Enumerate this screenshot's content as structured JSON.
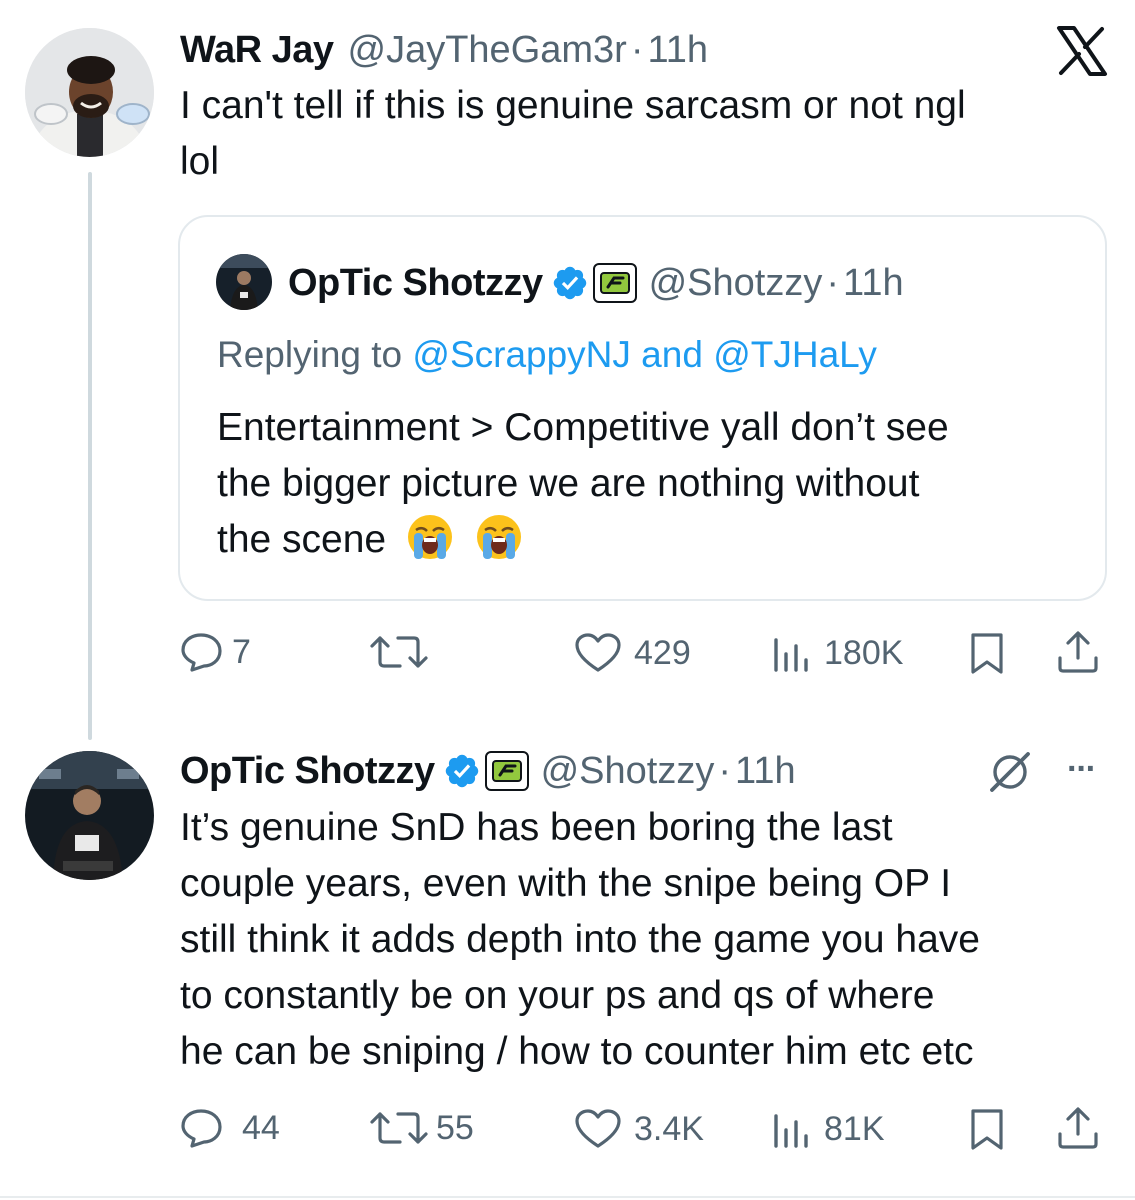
{
  "tweet1": {
    "author_name": "WaR Jay",
    "handle": "@JayTheGam3r",
    "time": "11h",
    "text_line1": "I can't tell if this is genuine sarcasm or not ngl",
    "text_line2": "lol",
    "quote": {
      "author_name": "OpTic Shotzzy",
      "handle": "@Shotzzy",
      "time": "11h",
      "replying_prefix": "Replying to ",
      "replying_user1": "@ScrappyNJ",
      "replying_and": " and ",
      "replying_user2": "@TJHaLy",
      "text_line1": "Entertainment > Competitive yall don’t see",
      "text_line2": "the bigger picture we are nothing without",
      "text_line3": "the scene"
    },
    "actions": {
      "replies": "7",
      "reposts": "",
      "likes": "429",
      "views": "180K"
    }
  },
  "tweet2": {
    "author_name": "OpTic Shotzzy",
    "handle": "@Shotzzy",
    "time": "11h",
    "more_label": "···",
    "text_lines": [
      "It’s genuine SnD has been boring the last",
      "couple years, even with the snipe being OP I",
      "still think it adds depth into the game you have",
      "to constantly be on your ps and qs of where",
      "he can be sniping / how to counter him etc etc"
    ],
    "actions": {
      "replies": "44",
      "reposts": "55",
      "likes": "3.4K",
      "views": "81K"
    }
  },
  "separator": "·",
  "icons": {
    "x_logo": "x-logo-icon",
    "verified": "verified-badge-icon",
    "affiliate": "optic-affiliate-icon",
    "grok": "grok-icon",
    "reply": "reply-icon",
    "repost": "repost-icon",
    "like": "heart-icon",
    "views": "views-icon",
    "bookmark": "bookmark-icon",
    "share": "share-icon",
    "emoji": "loudly-crying-face-icon"
  },
  "colors": {
    "text": "#0f1419",
    "secondary": "#536471",
    "link": "#1d9bf0",
    "verified": "#1d9bf0",
    "optic_green": "#92c83e",
    "border": "#e3e9ed"
  }
}
